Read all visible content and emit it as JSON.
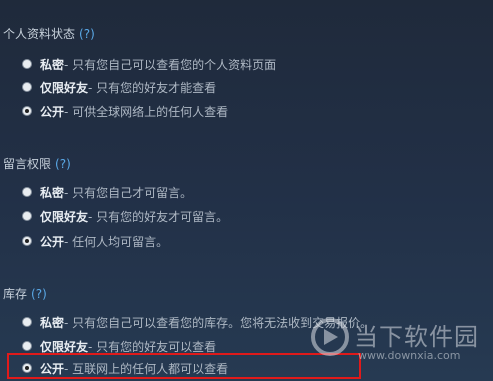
{
  "profile_status": {
    "title": "个人资料状态",
    "help": "(?)",
    "options": [
      {
        "label": "私密",
        "desc": " - 只有您自己可以查看您的个人资料页面",
        "checked": false
      },
      {
        "label": "仅限好友",
        "desc": " - 只有您的好友才能查看",
        "checked": false
      },
      {
        "label": "公开",
        "desc": " - 可供全球网络上的任何人查看",
        "checked": true
      }
    ]
  },
  "comment_permission": {
    "title": "留言权限",
    "help": "(?)",
    "options": [
      {
        "label": "私密",
        "desc": " - 只有您自己才可留言。",
        "checked": false
      },
      {
        "label": "仅限好友",
        "desc": " - 只有您的好友才可留言。",
        "checked": false
      },
      {
        "label": "公开",
        "desc": " - 任何人均可留言。",
        "checked": true
      }
    ]
  },
  "inventory": {
    "title": "库存",
    "help": "(?)",
    "options": [
      {
        "label": "私密",
        "desc": " - 只有您自己可以查看您的库存。您将无法收到交易报价。",
        "checked": false
      },
      {
        "label": "仅限好友",
        "desc": " - 只有您的好友可以查看",
        "checked": false
      },
      {
        "label": "公开",
        "desc": " - 互联网上的任何人都可以查看",
        "checked": true
      }
    ]
  },
  "watermark": {
    "title": "当下软件园",
    "url": "www.downxia.com"
  },
  "colors": {
    "highlight": "#e01a1a",
    "link": "#5aa8e6"
  }
}
